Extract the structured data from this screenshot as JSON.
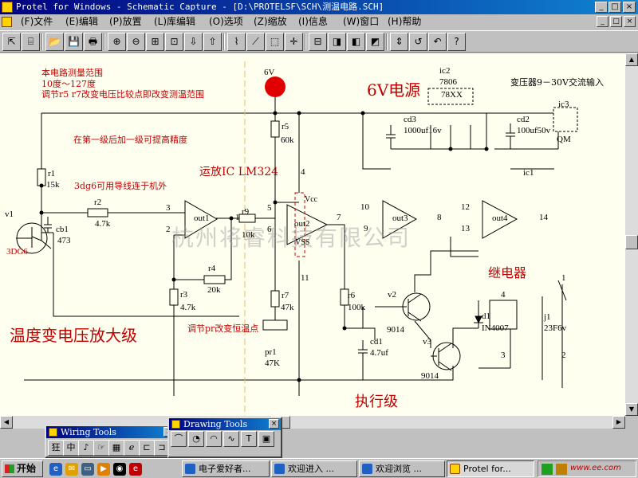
{
  "window": {
    "title": "Protel for Windows - Schematic Capture - [D:\\PROTELSF\\SCH\\测温电路.SCH]",
    "minimize": "_",
    "maximize": "□",
    "close": "×"
  },
  "menu": {
    "items": [
      "(F)文件",
      "(E)编辑",
      "(P)放置",
      "(L)库编辑",
      "(O)选项",
      "(Z)缩放",
      "(I)信息",
      "(W)窗口",
      "(H)帮助"
    ],
    "mdi": [
      "_",
      "□",
      "×"
    ]
  },
  "toolbar": {
    "icons": [
      "select-icon",
      "library-icon",
      "open-folder-icon",
      "save-icon",
      "print-icon",
      "zoom-in-icon",
      "zoom-out-icon",
      "zoom-area-icon",
      "zoom-fit-icon",
      "move-down-icon",
      "move-up-icon",
      "wire-icon",
      "bus-icon",
      "select-box-icon",
      "cross-icon",
      "component-icon",
      "library-a-icon",
      "library-b-icon",
      "library-c-icon",
      "scroll-icon",
      "rotate-icon",
      "undo-icon",
      "help-icon"
    ],
    "glyphs": [
      "⇱",
      "⌸",
      "📂",
      "💾",
      "🖶",
      "⊕",
      "⊖",
      "⊞",
      "⊡",
      "⇩",
      "⇧",
      "⌇",
      "⟋",
      "⬚",
      "✛",
      "⊟",
      "◨",
      "◧",
      "◩",
      "⇕",
      "↺",
      "↶",
      "?"
    ]
  },
  "schematic": {
    "notes": {
      "range_title": "本电路测量范围",
      "range_value": "10度～127度",
      "adjust_note": "调节r5 r7改变电压比较点即改变测温范围",
      "precision_note": "在第一级后加一级可提高精度",
      "ds_note": "3dg6可用导线连于机外",
      "opamp_note": "运放IC  LM324",
      "power_note": "6V电源",
      "transformer_note": "变压器9－30V交流输入",
      "amp_stage": "温度变电压放大级",
      "pr_note": "调节pr改变恒温点",
      "exec_stage": "执行级",
      "relay_note": "继电器",
      "watermark": "杭州将睿科技有限公司"
    },
    "labels": {
      "supply": "6V",
      "r1": "r1",
      "r1v": "15k",
      "r2": "r2",
      "r2v": "4.7k",
      "r3": "r3",
      "r3v": "4.7k",
      "r4": "r4",
      "r4v": "20k",
      "r5": "r5",
      "r5v": "60k",
      "r6": "r6",
      "r6v": "100k",
      "r7": "r7",
      "r7v": "47k",
      "r9": "r9",
      "r9v": "10k",
      "v1": "v1",
      "cb1": "cb1",
      "cb1v": "473",
      "q1type": "3DG6",
      "pr1": "pr1",
      "pr1v": "47K",
      "cd1": "cd1",
      "cd1v": "4.7uf",
      "cd2": "cd2",
      "cd2v": "100uf50v",
      "cd3": "cd3",
      "cd3v": "1000uf16v",
      "ic1": "ic1",
      "ic2": "ic2",
      "ic2v": "7806",
      "ic2pkg": "78XX",
      "ic3": "ic3",
      "ic3v": "QM",
      "v2": "v2",
      "v2type": "9014",
      "v3": "v3",
      "v3type": "9014",
      "d1": "d1",
      "d1v": "IN4007",
      "j1": "j1",
      "j1v": "23F6v",
      "out1": "out1",
      "out2": "out2",
      "out3": "out3",
      "out4": "out4",
      "vcc": "Vcc",
      "vss": "VSS",
      "pin3": "3",
      "pin2": "2",
      "pin1": "1",
      "pin5": "5",
      "pin6": "6",
      "pin7": "7",
      "pin4": "4",
      "pin11": "11",
      "pin10": "10",
      "pin9": "9",
      "pin8": "8",
      "pin12": "12",
      "pin13": "13",
      "pin14": "14",
      "relay4": "4",
      "relay3": "3",
      "relay1": "1",
      "relay2": "2"
    }
  },
  "palettes": {
    "wiring": {
      "title": "Wiring Tools",
      "close": "×",
      "glyphs": [
        "狂",
        "中",
        "♪",
        "☞",
        "▦",
        "ℯ",
        "⊏",
        "⊐"
      ]
    },
    "drawing": {
      "title": "Drawing Tools",
      "close": "×",
      "glyphs": [
        "⌒",
        "◔",
        "◠",
        "∿",
        "T",
        "▣",
        "⬚",
        "✎"
      ]
    }
  },
  "taskbar": {
    "start": "开始",
    "tasks": [
      "电子爱好者...",
      "欢迎进入 ...",
      "欢迎浏览 ...",
      "Protel for..."
    ],
    "tray_text": "www.ee.com"
  }
}
